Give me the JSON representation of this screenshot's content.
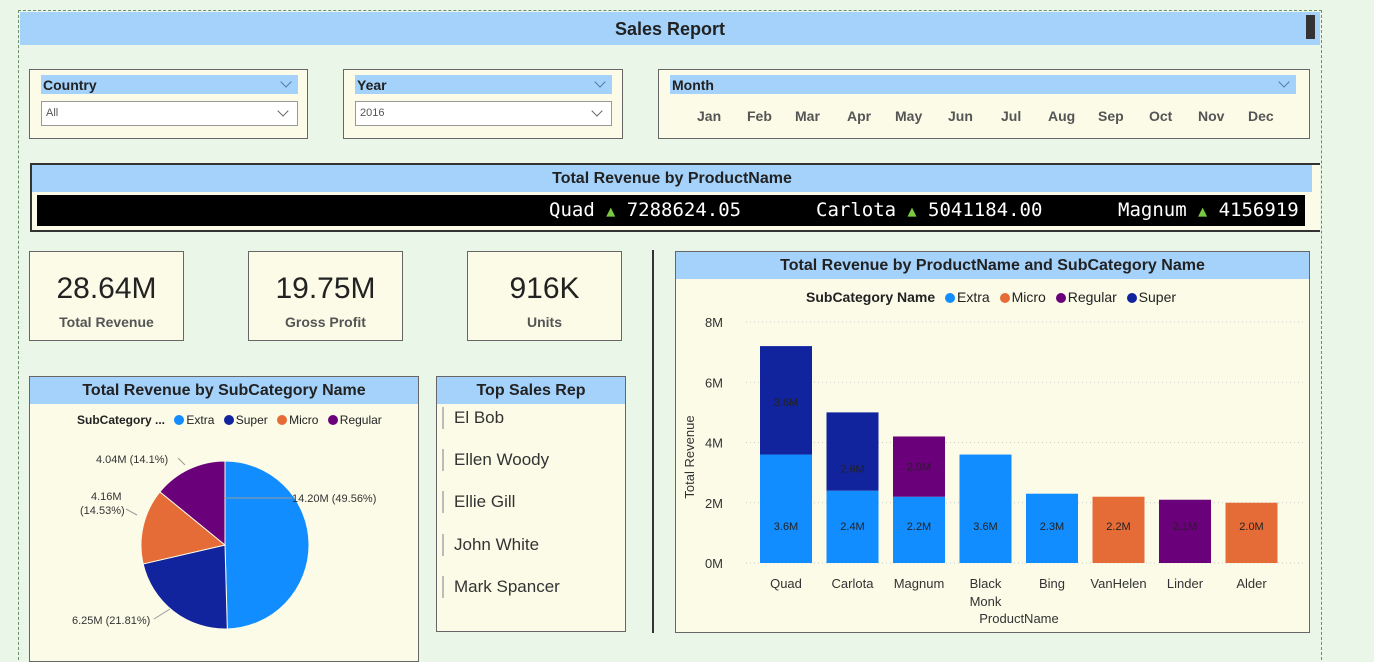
{
  "report_title": "Sales Report",
  "slicers": {
    "country": {
      "label": "Country",
      "value": "All"
    },
    "year": {
      "label": "Year",
      "value": "2016"
    },
    "month": {
      "label": "Month",
      "months": [
        "Jan",
        "Feb",
        "Mar",
        "Apr",
        "May",
        "Jun",
        "Jul",
        "Aug",
        "Sep",
        "Oct",
        "Nov",
        "Dec"
      ]
    }
  },
  "ticker": {
    "title": "Total Revenue by ProductName",
    "items": [
      {
        "name": "Quad",
        "value": "7288624.05"
      },
      {
        "name": "Carlota",
        "value": "5041184.00"
      },
      {
        "name": "Magnum",
        "value": "4156919"
      }
    ],
    "arrow": "▲",
    "up_color": "#7ac943"
  },
  "kpis": [
    {
      "value": "28.64M",
      "label": "Total Revenue"
    },
    {
      "value": "19.75M",
      "label": "Gross Profit"
    },
    {
      "value": "916K",
      "label": "Units"
    }
  ],
  "top_sales_rep": {
    "title": "Top Sales Rep",
    "names": [
      "El Bob",
      "Ellen Woody",
      "Ellie Gill",
      "John White",
      "Mark Spancer"
    ]
  },
  "colors": {
    "Extra": "#118dff",
    "Super": "#12239e",
    "Micro": "#e66c37",
    "Regular": "#6b007b"
  },
  "chart_data": [
    {
      "type": "pie",
      "title": "Total Revenue by SubCategory Name",
      "legend_title": "SubCategory ...",
      "legend": [
        "Extra",
        "Super",
        "Micro",
        "Regular"
      ],
      "slices": [
        {
          "name": "Extra",
          "value": 14.2,
          "label": "14.20M (49.56%)"
        },
        {
          "name": "Super",
          "value": 6.25,
          "label": "6.25M (21.81%)"
        },
        {
          "name": "Micro",
          "value": 4.16,
          "label_line1": "4.16M",
          "label_line2": "(14.53%)"
        },
        {
          "name": "Regular",
          "value": 4.04,
          "label": "4.04M (14.1%)"
        }
      ]
    },
    {
      "type": "bar",
      "stacked": true,
      "title": "Total Revenue by ProductName and SubCategory Name",
      "legend_title": "SubCategory Name",
      "legend": [
        "Extra",
        "Micro",
        "Regular",
        "Super"
      ],
      "xlabel": "ProductName",
      "ylabel": "Total Revenue",
      "ylim": [
        0,
        8
      ],
      "yticks": [
        "0M",
        "2M",
        "4M",
        "6M",
        "8M"
      ],
      "categories": [
        "Quad",
        "Carlota",
        "Magnum",
        "Black Monk",
        "Bing",
        "VanHelen",
        "Linder",
        "Alder"
      ],
      "series": [
        {
          "name": "Extra",
          "values": [
            3.6,
            2.4,
            2.2,
            3.6,
            2.3,
            0,
            0,
            0
          ],
          "labels": [
            "3.6M",
            "2.4M",
            "2.2M",
            "3.6M",
            "2.3M",
            "",
            "",
            ""
          ]
        },
        {
          "name": "Micro",
          "values": [
            0,
            0,
            0,
            0,
            0,
            2.2,
            0,
            2.0
          ],
          "labels": [
            "",
            "",
            "",
            "",
            "",
            "2.2M",
            "",
            "2.0M"
          ]
        },
        {
          "name": "Regular",
          "values": [
            0,
            0,
            2.0,
            0,
            0,
            0,
            2.1,
            0
          ],
          "labels": [
            "",
            "",
            "2.0M",
            "",
            "",
            "",
            "2.1M",
            ""
          ]
        },
        {
          "name": "Super",
          "values": [
            3.6,
            2.6,
            0,
            0,
            0,
            0,
            0,
            0
          ],
          "labels": [
            "3.6M",
            "2.6M",
            "",
            "",
            "",
            "",
            "",
            ""
          ]
        }
      ]
    }
  ]
}
